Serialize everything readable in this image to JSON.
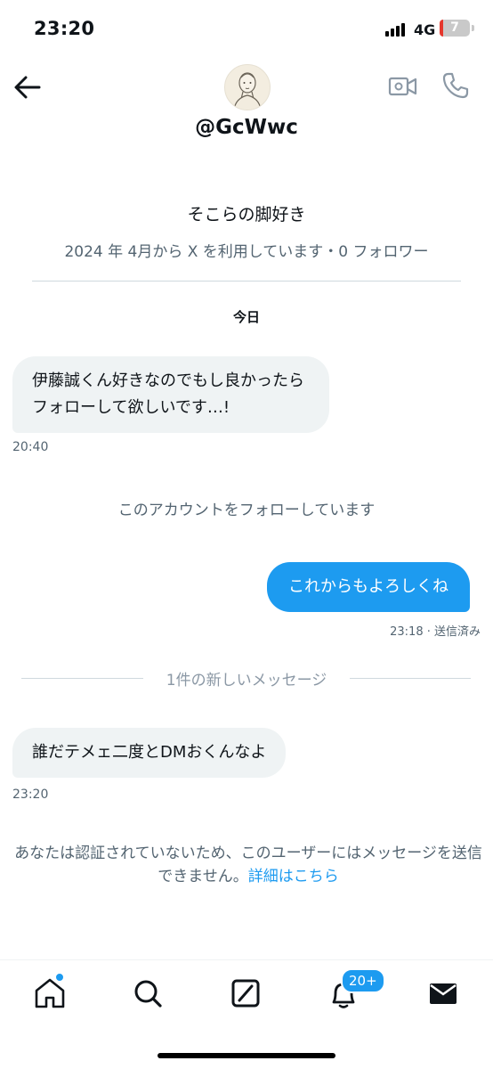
{
  "status": {
    "time": "23:20",
    "network": "4G",
    "battery": "7"
  },
  "header": {
    "handle": "@GcWwc"
  },
  "profile": {
    "name": "そこらの脚好き",
    "meta": "2024 年 4月から X を利用しています・0 フォロワー"
  },
  "conversation": {
    "date_label": "今日",
    "messages": [
      {
        "text": "伊藤誠くん好きなのでもし良かったらフォローして欲しいです…!",
        "time": "20:40"
      },
      {
        "text": "これからもよろしくね",
        "time": "23:18 · 送信済み"
      },
      {
        "text": "誰だテメェ二度とDMおくんなよ",
        "time": "23:20"
      }
    ],
    "follow_note": "このアカウントをフォローしています",
    "new_messages_label": "1件の新しいメッセージ",
    "notice": "あなたは認証されていないため、このユーザーにはメッセージを送信できません。",
    "notice_link": "詳細はこちら"
  },
  "tabbar": {
    "notifications_badge": "20+"
  },
  "colors": {
    "accent": "#1d9bf0",
    "secondary_text": "#536471",
    "bubble_in": "#eff3f4"
  },
  "icons": [
    "back-arrow-icon",
    "video-call-icon",
    "phone-icon",
    "home-icon",
    "search-icon",
    "grok-icon",
    "bell-icon",
    "mail-icon"
  ]
}
